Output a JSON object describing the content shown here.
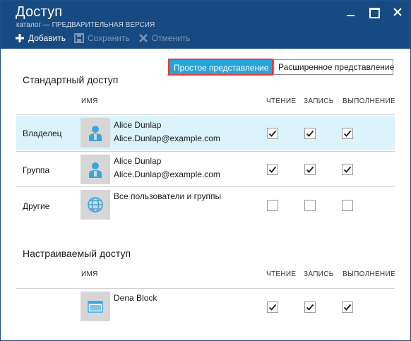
{
  "window": {
    "title": "Доступ",
    "subtitle": "каталог — ПРЕДВАРИТЕЛЬНАЯ ВЕРСИЯ"
  },
  "toolbar": {
    "add_label": "Добавить",
    "save_label": "Сохранить",
    "cancel_label": "Отменить"
  },
  "views": {
    "simple_label": "Простое представление",
    "advanced_label": "Расширенное представление"
  },
  "standard": {
    "title": "Стандартный доступ",
    "col_name": "ИМЯ",
    "col_read": "ЧТЕНИЕ",
    "col_write": "ЗАПИСЬ",
    "col_exec": "ВЫПОЛНЕНИЕ",
    "rows": [
      {
        "label": "Владелец",
        "name": "Alice Dunlap",
        "email": "Alice.Dunlap@example.com",
        "icon": "user-icon",
        "read": true,
        "write": true,
        "exec": true
      },
      {
        "label": "Группа",
        "name": "Alice Dunlap",
        "email": "Alice.Dunlap@example.com",
        "icon": "user-icon",
        "read": true,
        "write": true,
        "exec": true
      },
      {
        "label": "Другие",
        "name": "Все пользователи и группы",
        "email": "",
        "icon": "globe-icon",
        "read": false,
        "write": false,
        "exec": false
      }
    ]
  },
  "custom": {
    "title": "Настраиваемый доступ",
    "col_name": "ИМЯ",
    "col_read": "ЧТЕНИЕ",
    "col_write": "ЗАПИСЬ",
    "col_exec": "ВЫПОЛНЕНИЕ",
    "rows": [
      {
        "label": "",
        "name": "Dena Block",
        "email": "",
        "icon": "app-window-icon",
        "read": true,
        "write": true,
        "exec": true
      }
    ]
  },
  "colors": {
    "header_bg": "#184a82",
    "accent": "#28a4d9",
    "selection": "#dbf3fb",
    "highlight_border": "#e03a3e"
  }
}
